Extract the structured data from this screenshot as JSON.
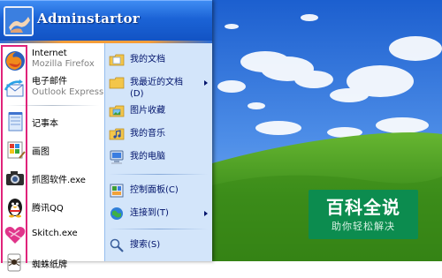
{
  "user": {
    "name": "Adminstartor"
  },
  "pinned_programs": [
    {
      "title": "Internet",
      "subtitle": "Mozilla Firefox",
      "icon": "firefox-icon"
    },
    {
      "title": "电子邮件",
      "subtitle": "Outlook Express",
      "icon": "outlook-express-icon"
    }
  ],
  "recent_programs": [
    {
      "label": "记事本",
      "icon": "notepad-icon"
    },
    {
      "label": "画图",
      "icon": "paint-icon"
    },
    {
      "label": "抓图软件.exe",
      "icon": "camera-icon"
    },
    {
      "label": "腾讯QQ",
      "icon": "qq-penguin-icon"
    },
    {
      "label": "Skitch.exe",
      "icon": "skitch-heart-icon"
    },
    {
      "label": "蜘蛛纸牌",
      "icon": "spider-solitaire-icon"
    }
  ],
  "places": [
    {
      "label": "我的文档",
      "icon": "my-documents-icon"
    },
    {
      "label": "我最近的文档",
      "label2": "(D)",
      "icon": "recent-documents-icon",
      "submenu": true
    },
    {
      "label": "图片收藏",
      "icon": "my-pictures-icon"
    },
    {
      "label": "我的音乐",
      "icon": "my-music-icon"
    },
    {
      "label": "我的电脑",
      "icon": "my-computer-icon"
    },
    {
      "label": "控制面板(C)",
      "icon": "control-panel-icon"
    },
    {
      "label": "连接到(T)",
      "icon": "connect-to-icon",
      "submenu": true
    },
    {
      "label": "搜索(S)",
      "icon": "search-icon"
    }
  ],
  "watermark": {
    "title": "百科全说",
    "subtitle": "助你轻松解决"
  },
  "colors": {
    "header_blue": "#1b63d6",
    "right_pane": "#d3e5fa",
    "highlight": "#e0237a",
    "watermark_green": "#0c8c4f"
  }
}
